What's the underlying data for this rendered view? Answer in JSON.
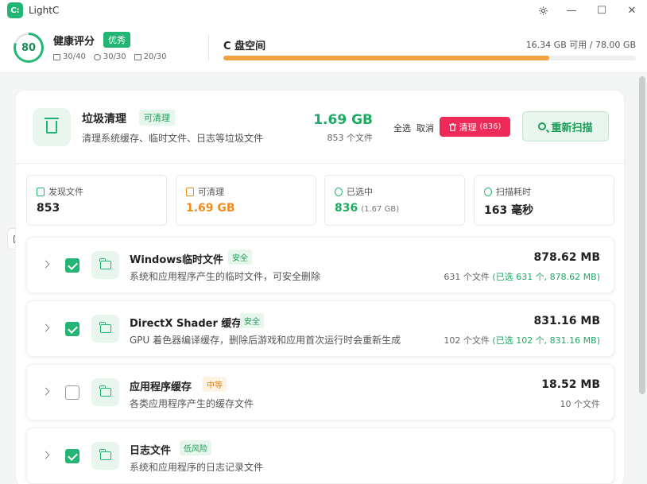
{
  "app": {
    "title": "LightC",
    "logo_text": "C:"
  },
  "window": {
    "settings_icon": "gear-icon",
    "minimize": "—",
    "maximize": "☐",
    "close": "✕"
  },
  "health": {
    "score": "80",
    "score_fraction": 0.8,
    "title": "健康评分",
    "badge": "优秀",
    "stats": [
      {
        "icon": "disk-icon",
        "value": "30/40"
      },
      {
        "icon": "moon-icon",
        "value": "30/30"
      },
      {
        "icon": "trash-icon",
        "value": "20/30"
      }
    ]
  },
  "disk": {
    "title": "C 盘空间",
    "info": "16.34 GB 可用 / 78.00 GB",
    "used_fraction": 0.79
  },
  "junk": {
    "title": "垃圾清理",
    "badge": "可清理",
    "desc": "清理系统缓存、临时文件、日志等垃圾文件",
    "size": "1.69 GB",
    "count": "853 个文件",
    "select_all": "全选",
    "cancel": "取消",
    "clean_label": "清理",
    "clean_count": "(836)",
    "rescan": "重新扫描"
  },
  "stats": [
    {
      "label": "发现文件",
      "value": "853",
      "sub": "",
      "color": "#222222",
      "icon": "file-icon"
    },
    {
      "label": "可清理",
      "value": "1.69 GB",
      "sub": "",
      "color": "#f08c1c",
      "icon": "trash-icon"
    },
    {
      "label": "已选中",
      "value": "836",
      "sub": "(1.67 GB)",
      "color": "#1eaa63",
      "icon": "check-circle-icon"
    },
    {
      "label": "扫描耗时",
      "value": "163 毫秒",
      "sub": "",
      "color": "#222222",
      "icon": "clock-icon"
    }
  ],
  "items": [
    {
      "title": "Windows临时文件",
      "tag": "安全",
      "tag_color": "green",
      "desc": "系统和应用程序产生的临时文件，可安全删除",
      "size": "878.62 MB",
      "count": "631 个文件",
      "selected": "(已选 631 个, 878.62 MB)",
      "checked": true
    },
    {
      "title": "DirectX Shader 缓存",
      "tag": "安全",
      "tag_color": "green",
      "desc": "GPU 着色器编译缓存，删除后游戏和应用首次运行时会重新生成",
      "size": "831.16 MB",
      "count": "102 个文件",
      "selected": "(已选 102 个, 831.16 MB)",
      "checked": true
    },
    {
      "title": "应用程序缓存",
      "tag": "中等",
      "tag_color": "orange",
      "desc": "各类应用程序产生的缓存文件",
      "size": "18.52 MB",
      "count": "10 个文件",
      "selected": "",
      "checked": false
    },
    {
      "title": "日志文件",
      "tag": "低风险",
      "tag_color": "green",
      "desc": "系统和应用程序的日志记录文件",
      "size": "",
      "count": "",
      "selected": "",
      "checked": true
    }
  ]
}
